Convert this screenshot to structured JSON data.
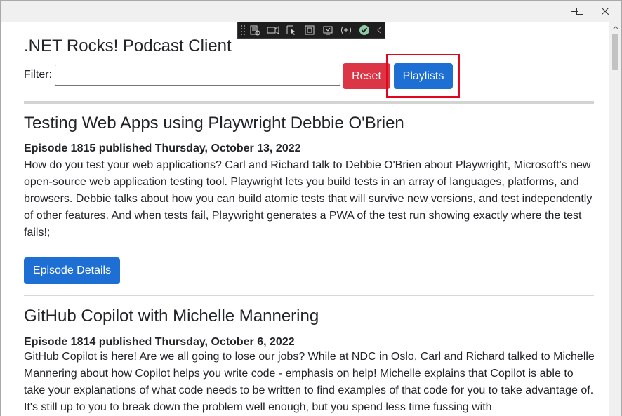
{
  "window": {
    "controls": {
      "minimize_icon": "minimize-icon",
      "maximize_icon": "maximize-icon",
      "close_icon": "close-icon"
    }
  },
  "dev_toolbar": {
    "icons": [
      "live-visual-tree-icon",
      "select-element-icon",
      "display-layout-adorners-icon",
      "track-focus-icon",
      "hot-reload-icon",
      "binding-failures-icon",
      "check-icon",
      "collapse-icon"
    ]
  },
  "app": {
    "title": ".NET Rocks! Podcast Client",
    "filter": {
      "label": "Filter:",
      "value": "",
      "placeholder": ""
    },
    "reset_label": "Reset",
    "playlists_label": "Playlists"
  },
  "episodes": [
    {
      "title": "Testing Web Apps using Playwright Debbie O'Brien",
      "meta": "Episode 1815 published Thursday, October 13, 2022",
      "description": "How do you test your web applications? Carl and Richard talk to Debbie O'Brien about Playwright, Microsoft's new open-source web application testing tool. Playwright lets you build tests in an array of languages, platforms, and browsers. Debbie talks about how you can build atomic tests that will survive new versions, and test independently of other features. And when tests fail, Playwright generates a PWA of the test run showing exactly where the test fails!;",
      "details_label": "Episode Details"
    },
    {
      "title": "GitHub Copilot with Michelle Mannering",
      "meta": "Episode 1814 published Thursday, October 6, 2022",
      "description": "GitHub Copilot is here! Are we all going to lose our jobs? While at NDC in Oslo, Carl and Richard talked to Michelle Mannering about how Copilot helps you write code - emphasis on help! Michelle explains that Copilot is able to take your explanations of what code needs to be written to find examples of that code for you to take advantage of. It's still up to you to break down the problem well enough, but you spend less time fussing with"
    }
  ],
  "colors": {
    "reset": "#dc3545",
    "primary": "#1d6fd3",
    "highlight": "#e1061d"
  }
}
